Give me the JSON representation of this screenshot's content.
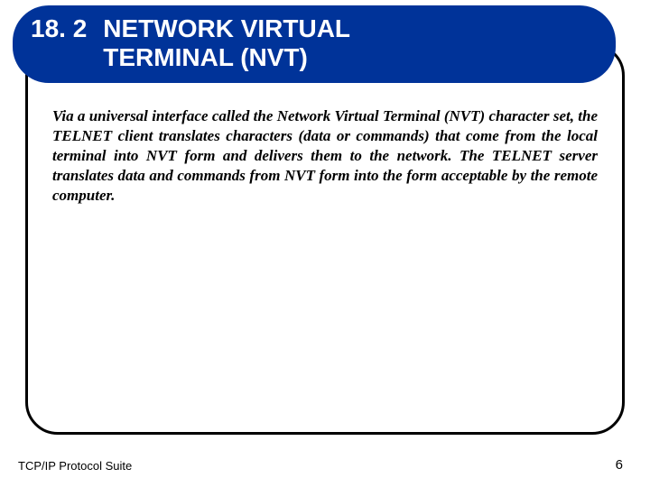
{
  "header": {
    "section_number": "18. 2",
    "title_line1": "NETWORK VIRTUAL",
    "title_line2": "TERMINAL (NVT)"
  },
  "body": {
    "paragraph": "Via a universal interface called the Network Virtual Terminal (NVT) character set, the TELNET client translates characters (data or commands) that come from the local terminal into NVT form and delivers them to the network. The TELNET server translates data and commands from NVT form into the form acceptable by the remote computer."
  },
  "footer": {
    "source": "TCP/IP Protocol Suite",
    "page_number": "6"
  }
}
